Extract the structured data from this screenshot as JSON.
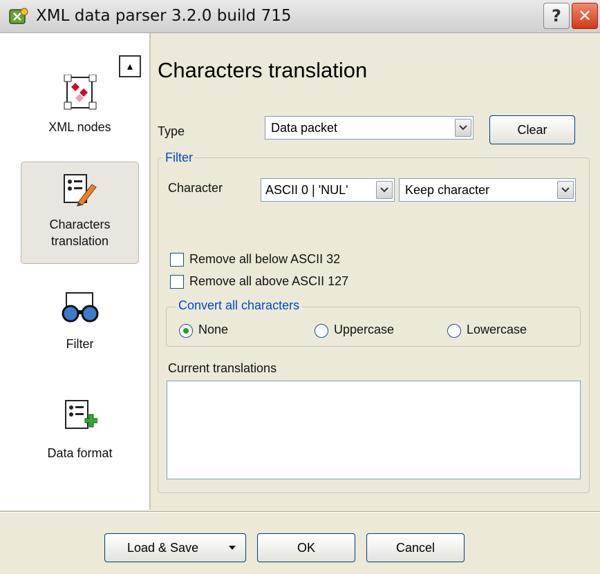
{
  "window": {
    "title": "XML data parser 3.2.0 build 715",
    "help_label": "?",
    "close_label": "✕"
  },
  "sidebar": {
    "items": [
      {
        "label": "XML nodes",
        "icon": "xml-nodes-icon"
      },
      {
        "label_line1": "Characters",
        "label_line2": "translation",
        "icon": "characters-translation-icon",
        "active": true
      },
      {
        "label": "Filter",
        "icon": "filter-icon"
      },
      {
        "label": "Data format",
        "icon": "data-format-icon"
      }
    ]
  },
  "page": {
    "title": "Characters translation"
  },
  "type_row": {
    "label": "Type",
    "value": "Data packet",
    "clear_label": "Clear"
  },
  "filter": {
    "legend": "Filter",
    "character_label": "Character",
    "character_value": "ASCII 0 | 'NUL'",
    "action_value": "Keep character",
    "remove_below": "Remove all below ASCII 32",
    "remove_above": "Remove all above ASCII 127",
    "convert": {
      "legend": "Convert all characters",
      "options": [
        "None",
        "Uppercase",
        "Lowercase"
      ],
      "selected": "None"
    },
    "current_translations_label": "Current translations"
  },
  "footer": {
    "load_save_label": "Load & Save",
    "ok_label": "OK",
    "cancel_label": "Cancel"
  },
  "colors": {
    "accent": "#0046d5",
    "close": "#d0391a",
    "radio_on": "#21a121"
  }
}
